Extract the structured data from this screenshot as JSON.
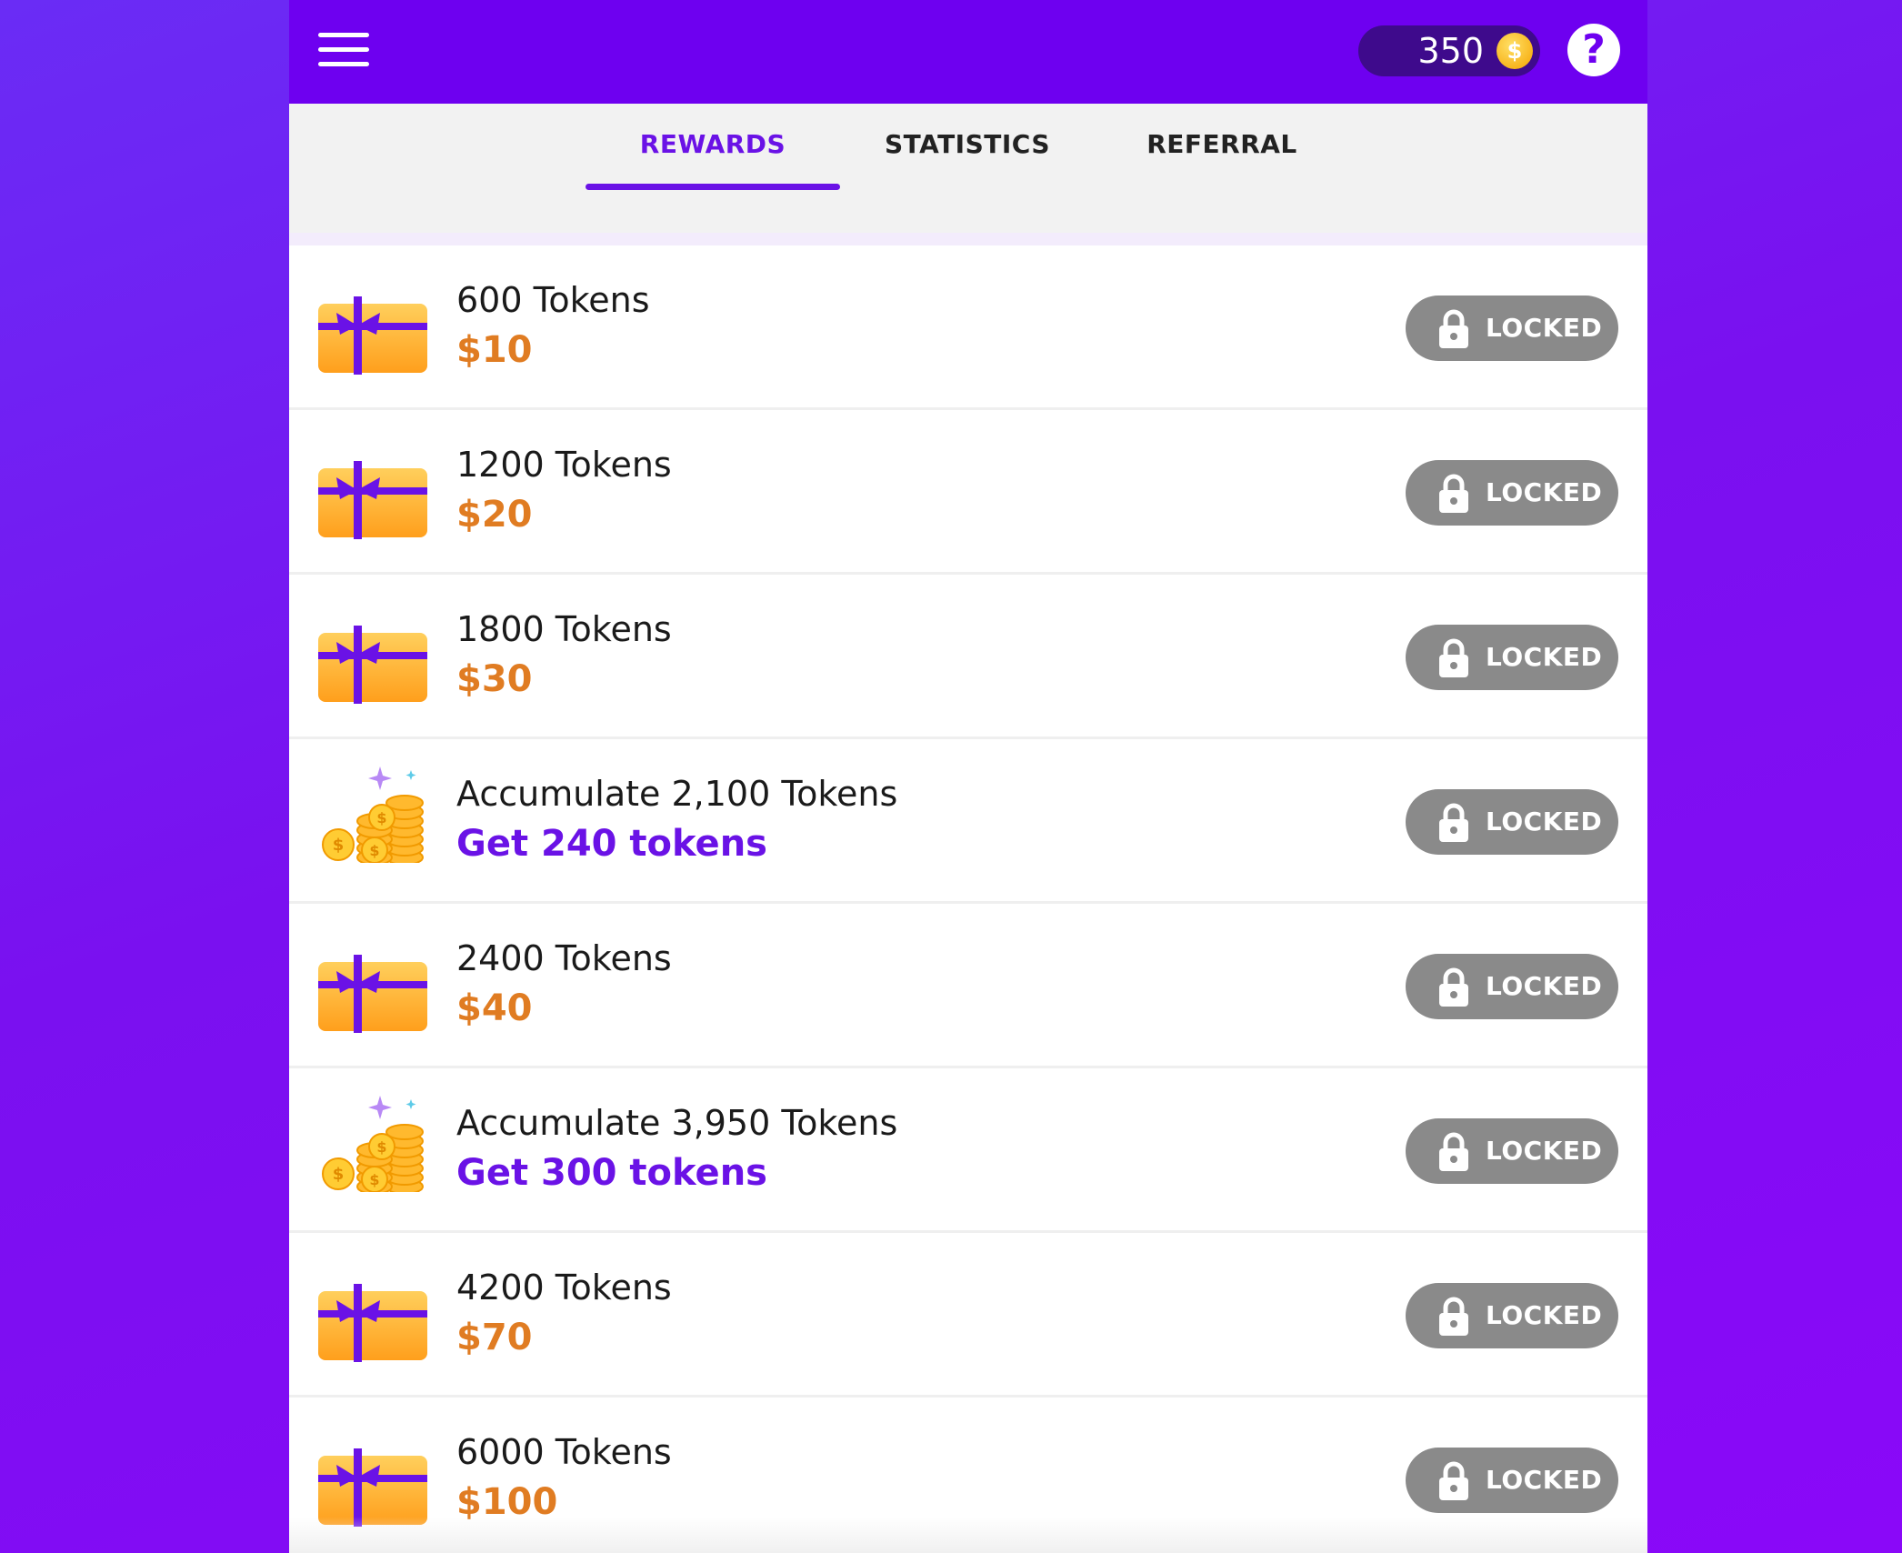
{
  "header": {
    "token_balance": "350",
    "coin_symbol": "$",
    "help_label": "?"
  },
  "tabs": [
    {
      "label": "REWARDS",
      "active": true
    },
    {
      "label": "STATISTICS",
      "active": false
    },
    {
      "label": "REFERRAL",
      "active": false
    }
  ],
  "rewards": [
    {
      "title": "600 Tokens",
      "subtitle": "$10",
      "icon": "gift-card-icon",
      "status": "LOCKED"
    },
    {
      "title": "1200 Tokens",
      "subtitle": "$20",
      "icon": "gift-card-icon",
      "status": "LOCKED"
    },
    {
      "title": "1800 Tokens",
      "subtitle": "$30",
      "icon": "gift-card-icon",
      "status": "LOCKED"
    },
    {
      "title": "Accumulate 2,100 Tokens",
      "subtitle": "Get 240 tokens",
      "icon": "coin-stack-icon",
      "status": "LOCKED"
    },
    {
      "title": "2400 Tokens",
      "subtitle": "$40",
      "icon": "gift-card-icon",
      "status": "LOCKED"
    },
    {
      "title": "Accumulate 3,950 Tokens",
      "subtitle": "Get 300 tokens",
      "icon": "coin-stack-icon",
      "status": "LOCKED"
    },
    {
      "title": "4200 Tokens",
      "subtitle": "$70",
      "icon": "gift-card-icon",
      "status": "LOCKED"
    },
    {
      "title": "6000 Tokens",
      "subtitle": "$100",
      "icon": "gift-card-icon",
      "status": "LOCKED"
    }
  ],
  "colors": {
    "brand_purple": "#6e00f0",
    "cash_orange": "#e07c22",
    "locked_gray": "#8a8a8a"
  }
}
